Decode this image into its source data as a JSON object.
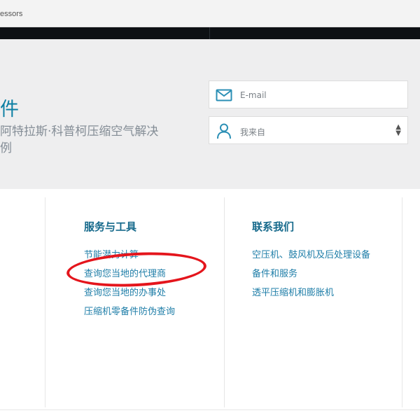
{
  "topbar": {
    "breadcrumb": "essors"
  },
  "hero": {
    "title": "件",
    "subtitle_line1": "阿特拉斯·科普柯压缩空气解决",
    "subtitle_line2": "例"
  },
  "form": {
    "email": {
      "placeholder": "E-mail",
      "icon": "envelope-icon"
    },
    "from": {
      "selected": "我来自",
      "icon": "user-icon",
      "chevron": "chevron-updown-icon"
    }
  },
  "columns": [
    {
      "heading": "服务与工具",
      "links": [
        "节能潜力计算",
        "查询您当地的代理商",
        "查询您当地的办事处",
        "压缩机零备件防伪查询"
      ]
    },
    {
      "heading": "联系我们",
      "links": [
        "空压机、鼓风机及后处理设备",
        "备件和服务",
        "透平压缩机和膨胀机"
      ]
    }
  ],
  "annotation": {
    "color": "#e4151c",
    "target": "查询您当地的代理商"
  },
  "colors": {
    "accent": "#0c7fa3",
    "heading": "#15698b",
    "link": "#1f7ea8",
    "annotation": "#e4151c"
  }
}
